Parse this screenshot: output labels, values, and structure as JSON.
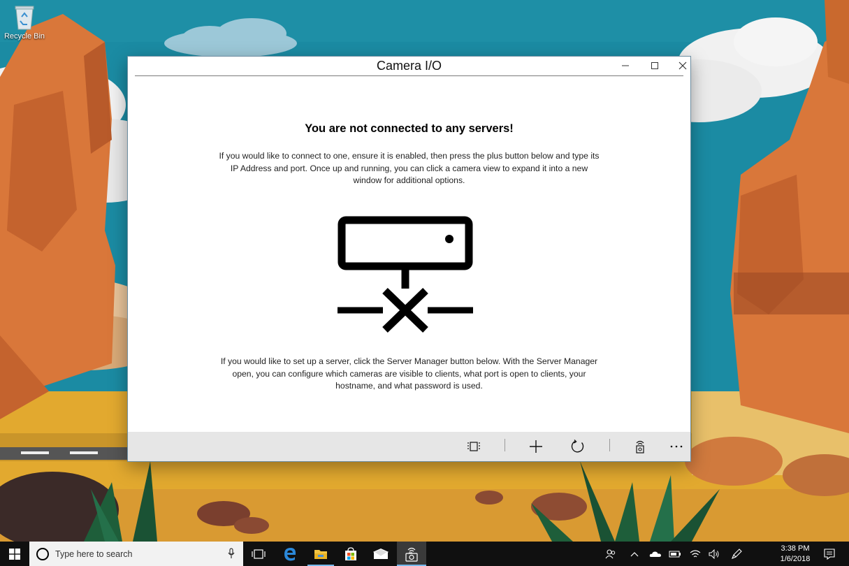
{
  "desktop": {
    "icons": [
      {
        "label": "Recycle Bin",
        "icon": "recycle-bin-icon"
      }
    ]
  },
  "window": {
    "title": "Camera I/O",
    "controls": {
      "minimize": "—",
      "maximize": "☐",
      "close": "✕"
    },
    "heading": "You are not connected to any servers!",
    "paragraph1": "If you would like to connect to one, ensure it is enabled, then press the plus button below and type its IP Address and port. Once up and running, you can click a camera view to expand it into a new window for additional options.",
    "illustration": "server-disconnected-icon",
    "paragraph2": "If you would like to set up a server, click the Server Manager button below. With the Server Manager open, you can configure which cameras are visible to clients, what port is open to clients, your hostname, and what password is used.",
    "appbar": {
      "buttons": [
        "view-layout-icon",
        "add-icon",
        "refresh-icon",
        "server-manager-icon",
        "more-icon"
      ]
    }
  },
  "taskbar": {
    "search_placeholder": "Type here to search",
    "pinned": [
      "task-view-icon",
      "edge-icon",
      "file-explorer-icon",
      "store-icon",
      "mail-icon",
      "camera-io-icon"
    ],
    "tray": [
      "people-icon",
      "chevron-up-icon",
      "onedrive-icon",
      "battery-icon",
      "wifi-icon",
      "volume-icon",
      "pen-icon",
      "notifications-icon"
    ],
    "time": "3:38 PM",
    "date": "1/6/2018"
  },
  "colors": {
    "sky": "#1a8aa0",
    "rock": "#d9773a",
    "sand": "#e0a930",
    "appbar": "#e6e6e6",
    "taskbar": "#101010",
    "accent": "#76b9ed"
  }
}
